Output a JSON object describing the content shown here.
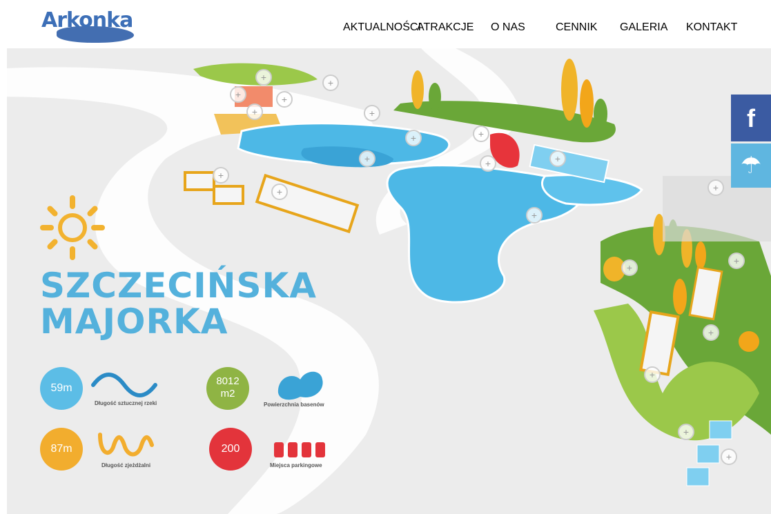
{
  "brand": {
    "logo_text": "Arkonka"
  },
  "nav": [
    "AKTUALNOŚCI",
    "ATRAKCJE",
    "O NAS",
    "CENNIK",
    "GALERIA",
    "KONTAKT"
  ],
  "side": {
    "facebook_glyph": "f",
    "weather_glyph": "☂"
  },
  "hero": {
    "title_line1": "SZCZECIŃSKA",
    "title_line2": "MAJORKA"
  },
  "stats": [
    {
      "value": "59m",
      "caption": "Długość sztucznej rzeki",
      "color": "#5cbde6"
    },
    {
      "value": "8012\nm2",
      "caption": "Powierzchnia basenów",
      "color": "#8fb444"
    },
    {
      "value": "87m",
      "caption": "Długość zjeżdżalni",
      "color": "#f2ad2e"
    },
    {
      "value": "200",
      "caption": "Miejsca parkingowe",
      "color": "#e3343b"
    }
  ],
  "colors": {
    "sky": "#ececec",
    "water": "#4db8e6",
    "grass": "#8fbf3e",
    "tree": "#f0b429"
  }
}
